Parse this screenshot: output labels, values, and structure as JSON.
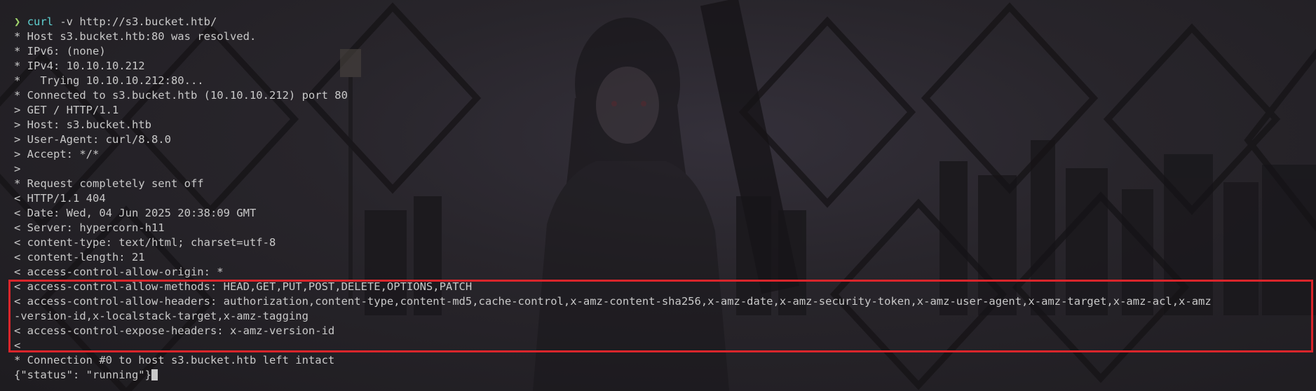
{
  "terminal": {
    "prompt_symbol": "❯",
    "command_name": "curl",
    "command_args": " -v http://s3.bucket.htb/",
    "lines": [
      "* Host s3.bucket.htb:80 was resolved.",
      "* IPv6: (none)",
      "* IPv4: 10.10.10.212",
      "*   Trying 10.10.10.212:80...",
      "* Connected to s3.bucket.htb (10.10.10.212) port 80",
      "> GET / HTTP/1.1",
      "> Host: s3.bucket.htb",
      "> User-Agent: curl/8.8.0",
      "> Accept: */*",
      ">",
      "* Request completely sent off",
      "< HTTP/1.1 404",
      "< Date: Wed, 04 Jun 2025 20:38:09 GMT",
      "< Server: hypercorn-h11",
      "< content-type: text/html; charset=utf-8",
      "< content-length: 21",
      "< access-control-allow-origin: *",
      "< access-control-allow-methods: HEAD,GET,PUT,POST,DELETE,OPTIONS,PATCH",
      "< access-control-allow-headers: authorization,content-type,content-md5,cache-control,x-amz-content-sha256,x-amz-date,x-amz-security-token,x-amz-user-agent,x-amz-target,x-amz-acl,x-amz",
      "-version-id,x-localstack-target,x-amz-tagging",
      "< access-control-expose-headers: x-amz-version-id",
      "<",
      "* Connection #0 to host s3.bucket.htb left intact",
      "{\"status\": \"running\"}"
    ]
  },
  "colors": {
    "highlight_border": "#d9252b",
    "prompt_arrow": "#9fd36b",
    "command": "#5fd0d0",
    "text": "#c9c9c9"
  }
}
